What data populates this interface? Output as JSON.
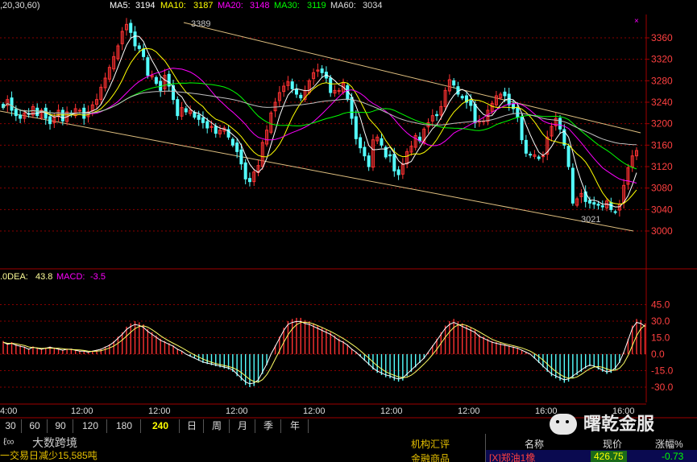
{
  "header": {
    "params": ",20,30,60)",
    "ma5_label": "MA5:",
    "ma5_value": "3194",
    "ma10_label": "MA10:",
    "ma10_value": "3187",
    "ma20_label": "MA20:",
    "ma20_value": "3148",
    "ma30_label": "MA30:",
    "ma30_value": "3119",
    "ma60_label": "MA60:",
    "ma60_value": "3034",
    "colors": {
      "ma5": "#ffffff",
      "ma10": "#ffff00",
      "ma20": "#ff00ff",
      "ma30": "#00ff00",
      "ma60": "#c0c0c0"
    }
  },
  "macd_header": {
    "dea_label": ".0DEA:",
    "dea_value": "43.8",
    "macd_label": "MACD:",
    "macd_value": "-3.5"
  },
  "annotations": {
    "high": "3389",
    "low": "3021"
  },
  "time_axis": [
    "4:00",
    "12:00",
    "12:00",
    "12:00",
    "12:00",
    "12:00",
    "12:00",
    "16:00",
    "16:00"
  ],
  "periods": [
    "30",
    "60",
    "90",
    "120",
    "180",
    "240",
    "日",
    "周",
    "月",
    "季",
    "年"
  ],
  "active_period": "240",
  "watermark_left": "大数跨境",
  "watermark_right": "曙乾金服",
  "bottom": {
    "info_text": "一交易日减少15,585吨",
    "menu": [
      "机构汇评",
      "金融商品"
    ],
    "table_headers": [
      "名称",
      "现价",
      "涨幅%"
    ],
    "row": {
      "name": "[X]郑油1橡",
      "price": "426.75",
      "change": "-0.73"
    }
  },
  "chart_data": [
    {
      "type": "candlestick",
      "title": "",
      "y_ticks": [
        3000,
        3040,
        3080,
        3120,
        3160,
        3200,
        3240,
        3280,
        3320,
        3360
      ],
      "ylim": [
        2980,
        3390
      ],
      "grid": true,
      "annotations": [
        {
          "label": "3389",
          "value": 3389
        },
        {
          "label": "3021",
          "value": 3021
        }
      ],
      "moving_averages": [
        {
          "name": "MA5",
          "value": 3194
        },
        {
          "name": "MA10",
          "value": 3187
        },
        {
          "name": "MA20",
          "value": 3148
        },
        {
          "name": "MA30",
          "value": 3119
        },
        {
          "name": "MA60",
          "value": 3034
        }
      ],
      "close": [
        3230,
        3245,
        3225,
        3215,
        3210,
        3220,
        3218,
        3232,
        3215,
        3225,
        3210,
        3200,
        3212,
        3225,
        3205,
        3222,
        3218,
        3228,
        3225,
        3210,
        3222,
        3235,
        3245,
        3268,
        3285,
        3305,
        3325,
        3345,
        3372,
        3385,
        3370,
        3345,
        3340,
        3325,
        3290,
        3290,
        3275,
        3262,
        3290,
        3270,
        3245,
        3215,
        3230,
        3222,
        3225,
        3212,
        3208,
        3202,
        3192,
        3195,
        3182,
        3188,
        3192,
        3175,
        3160,
        3148,
        3125,
        3097,
        3092,
        3110,
        3122,
        3165,
        3188,
        3220,
        3240,
        3258,
        3270,
        3278,
        3265,
        3255,
        3248,
        3262,
        3280,
        3295,
        3300,
        3295,
        3285,
        3258,
        3262,
        3262,
        3275,
        3245,
        3210,
        3172,
        3155,
        3140,
        3120,
        3170,
        3175,
        3160,
        3138,
        3140,
        3112,
        3105,
        3125,
        3148,
        3158,
        3178,
        3168,
        3190,
        3202,
        3215,
        3215,
        3232,
        3262,
        3282,
        3272,
        3255,
        3248,
        3240,
        3234,
        3202,
        3205,
        3205,
        3225,
        3238,
        3252,
        3255,
        3252,
        3235,
        3228,
        3212,
        3170,
        3145,
        3142,
        3142,
        3135,
        3140,
        3175,
        3195,
        3210,
        3190,
        3160,
        3120,
        3052,
        3060,
        3070,
        3055,
        3052,
        3050,
        3048,
        3045,
        3056,
        3040,
        3035,
        3050,
        3085,
        3118,
        3140,
        3150
      ],
      "macd": [
        12,
        10,
        11,
        9,
        8,
        7,
        5,
        7,
        6,
        5,
        6,
        7,
        6,
        5,
        4,
        5,
        5,
        4,
        3,
        3,
        2,
        3,
        4,
        5,
        7,
        9,
        12,
        16,
        20,
        25,
        28,
        30,
        29,
        27,
        23,
        20,
        17,
        14,
        12,
        10,
        8,
        5,
        3,
        0,
        -2,
        -4,
        -6,
        -8,
        -9,
        -10,
        -11,
        -12,
        -13,
        -14,
        -16,
        -20,
        -24,
        -28,
        -30,
        -29,
        -26,
        -18,
        -10,
        0,
        8,
        16,
        24,
        30,
        32,
        33,
        33,
        31,
        30,
        28,
        26,
        24,
        22,
        20,
        17,
        14,
        12,
        9,
        5,
        2,
        -2,
        -6,
        -10,
        -14,
        -17,
        -19,
        -21,
        -22,
        -24,
        -25,
        -24,
        -20,
        -16,
        -12,
        -8,
        -4,
        2,
        8,
        14,
        20,
        26,
        30,
        32,
        30,
        28,
        26,
        24,
        22,
        18,
        16,
        14,
        12,
        11,
        10,
        9,
        8,
        7,
        6,
        4,
        2,
        0,
        -4,
        -8,
        -12,
        -16,
        -20,
        -22,
        -24,
        -26,
        -25,
        -22,
        -19,
        -16,
        -13,
        -11,
        -12,
        -14,
        -16,
        -18,
        -17,
        -14,
        -8,
        2,
        14,
        26,
        32,
        31,
        28
      ]
    }
  ]
}
